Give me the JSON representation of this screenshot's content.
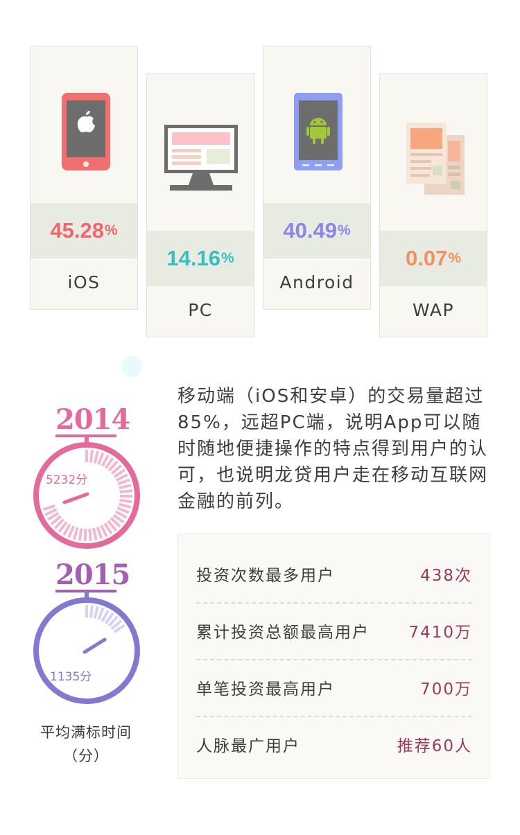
{
  "platforms": [
    {
      "name": "iOS",
      "percent": "45.28",
      "color": "#f0666e"
    },
    {
      "name": "PC",
      "percent": "14.16",
      "color": "#36bfbf"
    },
    {
      "name": "Android",
      "percent": "40.49",
      "color": "#8e86e6"
    },
    {
      "name": "WAP",
      "percent": "0.07",
      "color": "#f2915b"
    }
  ],
  "percent_sign": "%",
  "description": "移动端（iOS和安卓）的交易量超过85%，远超PC端，说明App可以随时随地便捷操作的特点得到用户的认可，也说明龙贷用户走在移动互联网金融的前列。",
  "gauges": [
    {
      "year": "2014",
      "value": "5232分",
      "color": "#e26a9c"
    },
    {
      "year": "2015",
      "value": "1135分",
      "color": "#8478d0"
    }
  ],
  "avg_label_line1": "平均满标时间",
  "avg_label_line2": "（分）",
  "stats": [
    {
      "label": "投资次数最多用户",
      "value": "438次"
    },
    {
      "label": "累计投资总额最高用户",
      "value": "7410万"
    },
    {
      "label": "单笔投资最高用户",
      "value": "700万"
    },
    {
      "label": "人脉最广用户",
      "value": "推荐60人"
    }
  ]
}
